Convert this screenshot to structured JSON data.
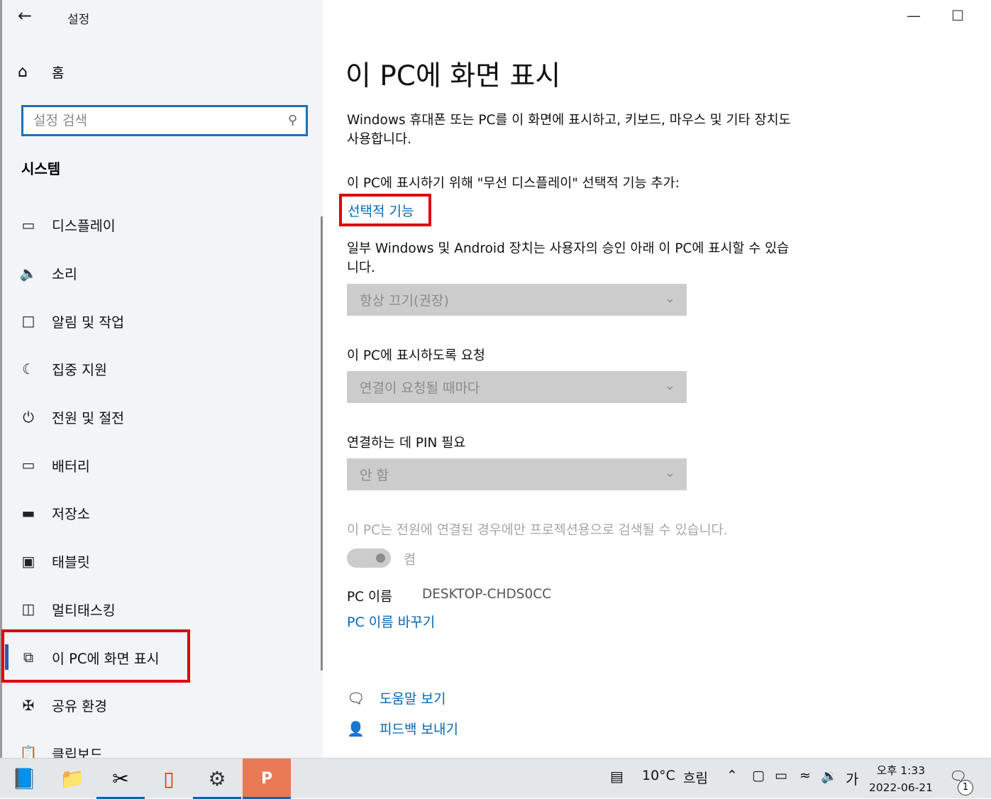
{
  "window": {
    "title": "설정",
    "back_icon": "arrow-left-icon",
    "minimize_icon": "minimize-icon",
    "maximize_icon": "maximize-icon"
  },
  "sidebar": {
    "home_label": "홈",
    "search_placeholder": "설정 검색",
    "section_title": "시스템",
    "items": [
      {
        "label": "디스플레이",
        "icon": "monitor-icon"
      },
      {
        "label": "소리",
        "icon": "speaker-icon"
      },
      {
        "label": "알림 및 작업",
        "icon": "notification-icon"
      },
      {
        "label": "집중 지원",
        "icon": "moon-icon"
      },
      {
        "label": "전원 및 절전",
        "icon": "power-icon"
      },
      {
        "label": "배터리",
        "icon": "battery-icon"
      },
      {
        "label": "저장소",
        "icon": "storage-icon"
      },
      {
        "label": "태블릿",
        "icon": "tablet-icon"
      },
      {
        "label": "멀티태스킹",
        "icon": "multitasking-icon"
      },
      {
        "label": "이 PC에 화면 표시",
        "icon": "project-icon",
        "active": true
      },
      {
        "label": "공유 환경",
        "icon": "shared-icon"
      },
      {
        "label": "클립보드",
        "icon": "clipboard-icon"
      }
    ]
  },
  "main": {
    "title": "이 PC에 화면 표시",
    "description": "Windows 휴대폰 또는 PC를 이 화면에 표시하고, 키보드, 마우스 및 기타 장치도 사용합니다.",
    "add_feature_text": "이 PC에 표시하기 위해 \"무선 디스플레이\" 선택적 기능 추가:",
    "optional_features_link": "선택적 기능",
    "some_devices_text": "일부 Windows 및 Android 장치는 사용자의 승인 아래 이 PC에 표시할 수 있습니다.",
    "dropdown1_value": "항상 끄기(권장)",
    "ask_label": "이 PC에 표시하도록 요청",
    "dropdown2_value": "연결이 요청될 때마다",
    "pin_label": "연결하는 데 PIN 필요",
    "dropdown3_value": "안 함",
    "power_note": "이 PC는 전원에 연결된 경우에만 프로젝션용으로 검색될 수 있습니다.",
    "toggle_label": "켬",
    "pc_name_label": "PC 이름",
    "pc_name_value": "DESKTOP-CHDS0CC",
    "rename_link": "PC 이름 바꾸기",
    "help_link": "도움말 보기",
    "feedback_link": "피드백 보내기"
  },
  "taskbar": {
    "apps": [
      "notepad-icon",
      "file-explorer-icon",
      "snipping-tool-icon",
      "office-icon",
      "settings-icon",
      "powerpoint-icon"
    ],
    "weather_temp": "10°C",
    "weather_text": "흐림",
    "ime_label": "가",
    "clock_time": "오후 1:33",
    "clock_date": "2022-06-21",
    "notification_count": "1"
  },
  "colors": {
    "link": "#0067b8",
    "highlight": "#e00000",
    "accent": "#1e6fb7"
  }
}
